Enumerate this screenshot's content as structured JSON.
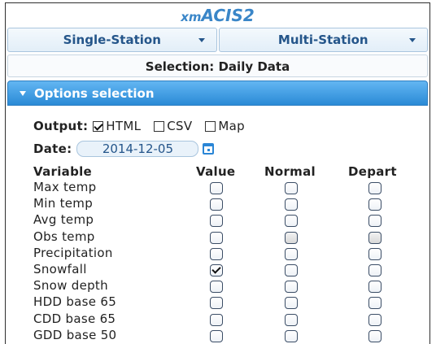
{
  "app": {
    "title_prefix": "xm",
    "title_main": "ACIS2"
  },
  "nav": [
    {
      "label": "Single-Station"
    },
    {
      "label": "Multi-Station"
    }
  ],
  "selection_label": "Selection: Daily Data",
  "options": {
    "header": "Options selection",
    "output_label": "Output:",
    "outputs": [
      {
        "label": "HTML",
        "checked": true
      },
      {
        "label": "CSV",
        "checked": false
      },
      {
        "label": "Map",
        "checked": false
      }
    ],
    "date_label": "Date:",
    "date_value": "2014-12-05"
  },
  "table": {
    "headers": {
      "variable": "Variable",
      "value": "Value",
      "normal": "Normal",
      "depart": "Depart"
    },
    "rows": [
      {
        "name": "Max temp",
        "value": false,
        "normal": false,
        "depart": false,
        "normal_gray": false,
        "depart_gray": false
      },
      {
        "name": "Min temp",
        "value": false,
        "normal": false,
        "depart": false,
        "normal_gray": false,
        "depart_gray": false
      },
      {
        "name": "Avg temp",
        "value": false,
        "normal": false,
        "depart": false,
        "normal_gray": false,
        "depart_gray": false
      },
      {
        "name": "Obs temp",
        "value": false,
        "normal": false,
        "depart": false,
        "normal_gray": true,
        "depart_gray": true
      },
      {
        "name": "Precipitation",
        "value": false,
        "normal": false,
        "depart": false,
        "normal_gray": false,
        "depart_gray": false
      },
      {
        "name": "Snowfall",
        "value": true,
        "normal": false,
        "depart": false,
        "normal_gray": false,
        "depart_gray": false
      },
      {
        "name": "Snow depth",
        "value": false,
        "normal": false,
        "depart": false,
        "normal_gray": false,
        "depart_gray": false
      },
      {
        "name": "HDD base 65",
        "value": false,
        "normal": false,
        "depart": false,
        "normal_gray": false,
        "depart_gray": false
      },
      {
        "name": "CDD base 65",
        "value": false,
        "normal": false,
        "depart": false,
        "normal_gray": false,
        "depart_gray": false
      },
      {
        "name": "GDD base 50",
        "value": false,
        "normal": false,
        "depart": false,
        "normal_gray": false,
        "depart_gray": false
      }
    ]
  }
}
